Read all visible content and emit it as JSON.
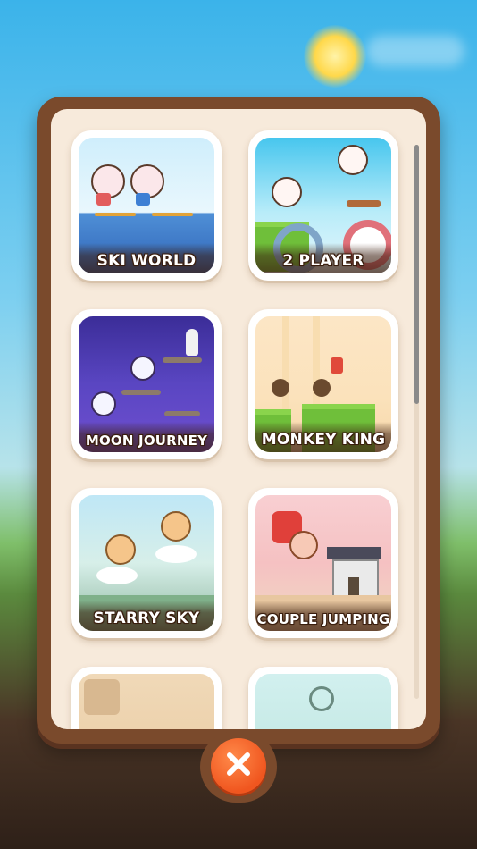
{
  "modes": [
    {
      "label": "SKI WORLD",
      "icon": "ski-bunnies-thumbnail"
    },
    {
      "label": "2 PLAYER",
      "icon": "two-player-bunnies-thumbnail"
    },
    {
      "label": "MOON JOURNEY",
      "icon": "space-bunnies-thumbnail"
    },
    {
      "label": "MONKEY KING",
      "icon": "monkey-king-thumbnail"
    },
    {
      "label": "STARRY SKY",
      "icon": "starry-sky-monkeys-thumbnail"
    },
    {
      "label": "COUPLE JUMPING",
      "icon": "couple-jumping-thumbnail"
    },
    {
      "label": "",
      "icon": "partial-mode-thumbnail"
    },
    {
      "label": "",
      "icon": "partial-mode-thumbnail"
    }
  ],
  "close_button": {
    "icon": "close-icon",
    "color": "#f0561f"
  },
  "colors": {
    "panel_frame": "#7a4a2c",
    "panel_fill": "#f7eadb",
    "card_bg": "#ffffff"
  }
}
